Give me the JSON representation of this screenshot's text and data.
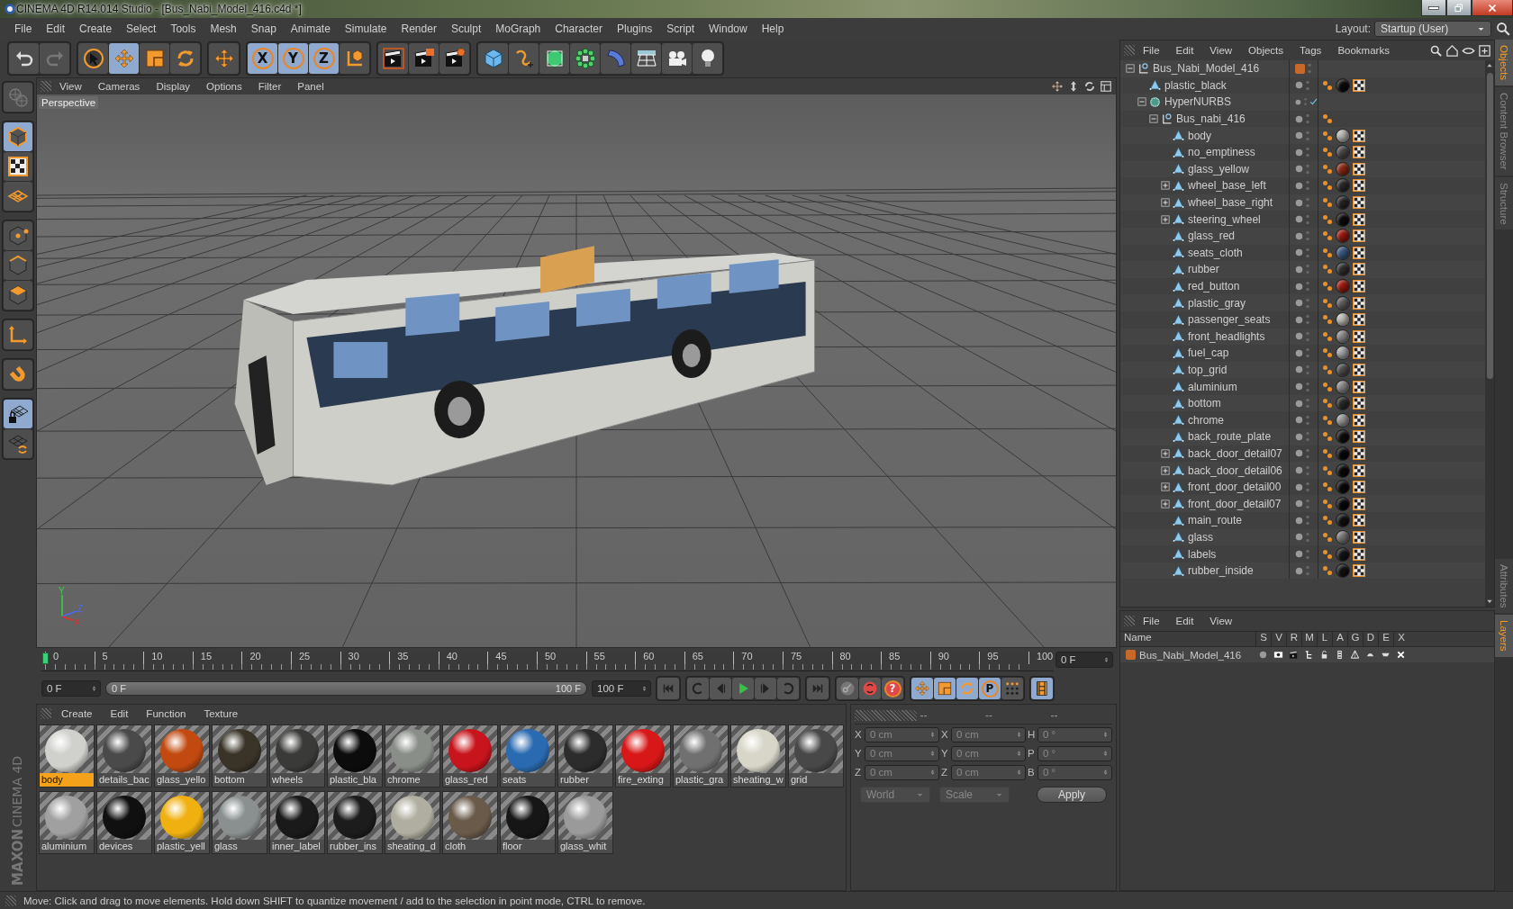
{
  "window": {
    "title": "CINEMA 4D R14.014 Studio - [Bus_Nabi_Model_416.c4d *]"
  },
  "menu": [
    "File",
    "Edit",
    "Create",
    "Select",
    "Tools",
    "Mesh",
    "Snap",
    "Animate",
    "Simulate",
    "Render",
    "Sculpt",
    "MoGraph",
    "Character",
    "Plugins",
    "Script",
    "Window",
    "Help"
  ],
  "layout": {
    "label": "Layout:",
    "value": "Startup (User)"
  },
  "toolbar": [
    [
      {
        "kind": "undo",
        "active": false
      },
      {
        "kind": "redo",
        "active": false
      }
    ],
    [
      {
        "kind": "pointer",
        "active": false
      },
      {
        "kind": "move",
        "active": true
      },
      {
        "kind": "scale",
        "active": false
      },
      {
        "kind": "rotate",
        "active": false
      }
    ],
    [
      {
        "kind": "move",
        "active": false
      }
    ],
    [
      {
        "kind": "axis",
        "label": "X",
        "active": true
      },
      {
        "kind": "axis",
        "label": "Y",
        "active": true
      },
      {
        "kind": "axis",
        "label": "Z",
        "active": true
      },
      {
        "kind": "coord",
        "active": false
      }
    ],
    [
      {
        "kind": "render-view",
        "active": false
      },
      {
        "kind": "render-picture",
        "active": false
      },
      {
        "kind": "render-settings",
        "active": false
      }
    ],
    [
      {
        "kind": "cube",
        "active": false
      },
      {
        "kind": "spline",
        "active": false
      },
      {
        "kind": "nurbs",
        "active": false
      },
      {
        "kind": "array",
        "active": false
      },
      {
        "kind": "deformer",
        "active": false
      },
      {
        "kind": "floor",
        "active": false
      },
      {
        "kind": "camera",
        "active": false
      },
      {
        "kind": "light",
        "active": false
      }
    ]
  ],
  "mode_bar": [
    [
      {
        "kind": "globe",
        "active": false
      }
    ],
    [
      {
        "kind": "model",
        "active": true
      },
      {
        "kind": "checker",
        "active": false
      },
      {
        "kind": "workplane",
        "active": false
      }
    ],
    [
      {
        "kind": "points",
        "active": false
      },
      {
        "kind": "edges",
        "active": false
      },
      {
        "kind": "polygons",
        "active": false
      }
    ],
    [
      {
        "kind": "axes",
        "active": false
      }
    ],
    [
      {
        "kind": "magnet",
        "active": false
      }
    ],
    [
      {
        "kind": "grid-lock",
        "active": true
      },
      {
        "kind": "grid-rotate",
        "active": false
      }
    ]
  ],
  "brand": {
    "company": "MAXON",
    "product": "CINEMA 4D"
  },
  "viewport": {
    "menu": [
      "View",
      "Cameras",
      "Display",
      "Options",
      "Filter",
      "Panel"
    ],
    "camera_label": "Perspective",
    "axis_labels": [
      "Y",
      "Z",
      "X"
    ]
  },
  "timeline": {
    "ticks": [
      "0",
      "5",
      "10",
      "15",
      "20",
      "25",
      "30",
      "35",
      "40",
      "45",
      "50",
      "55",
      "60",
      "65",
      "70",
      "75",
      "80",
      "85",
      "90",
      "95",
      "100"
    ],
    "playhead": {
      "level": 0
    },
    "current_frame": "0 F",
    "start": "0 F",
    "range": {
      "start": "0 F",
      "end": "100 F",
      "level": 1
    },
    "end": "100 F",
    "transport": [
      [
        {
          "kind": "skip-start",
          "active": false
        }
      ],
      [
        {
          "kind": "loop-back",
          "active": false
        },
        {
          "kind": "step-back",
          "active": false
        },
        {
          "kind": "play",
          "active": false
        },
        {
          "kind": "step-forward",
          "active": false
        },
        {
          "kind": "loop-forward",
          "active": false
        }
      ],
      [
        {
          "kind": "skip-end",
          "active": false
        }
      ],
      [
        {
          "kind": "key",
          "active": false
        },
        {
          "kind": "record",
          "active": false
        },
        {
          "kind": "help",
          "label": "?",
          "active": false
        }
      ],
      [
        {
          "kind": "move",
          "active": true
        },
        {
          "kind": "scale",
          "active": true
        },
        {
          "kind": "rotate",
          "active": true
        },
        {
          "kind": "param",
          "label": "P",
          "active": true
        },
        {
          "kind": "dots",
          "active": false
        }
      ],
      [
        {
          "kind": "film",
          "active": true
        }
      ]
    ]
  },
  "materials": {
    "menu": [
      "Create",
      "Edit",
      "Function",
      "Texture"
    ],
    "items": [
      {
        "name": "body",
        "color": "#d0d0cc",
        "selected": true
      },
      {
        "name": "details_bac",
        "color": "#4a4a4a",
        "selected": false
      },
      {
        "name": "glass_yello",
        "color": "#c24a10",
        "selected": false
      },
      {
        "name": "bottom",
        "color": "#3a3428",
        "selected": false
      },
      {
        "name": "wheels",
        "color": "#3a3a38",
        "selected": false
      },
      {
        "name": "plastic_bla",
        "color": "#0c0c0c",
        "selected": false
      },
      {
        "name": "chrome",
        "color": "#8a8e88",
        "selected": false
      },
      {
        "name": "glass_red",
        "color": "#c8141c",
        "selected": false
      },
      {
        "name": "seats",
        "color": "#2a6ab0",
        "selected": false
      },
      {
        "name": "rubber",
        "color": "#2c2c2c",
        "selected": false
      },
      {
        "name": "fire_exting",
        "color": "#d81818",
        "selected": false
      },
      {
        "name": "plastic_gra",
        "color": "#707070",
        "selected": false
      },
      {
        "name": "sheating_w",
        "color": "#d8d6c8",
        "selected": false
      },
      {
        "name": "grid",
        "color": "#484848",
        "selected": false
      },
      {
        "name": "aluminium",
        "color": "#a0a0a0",
        "selected": false
      },
      {
        "name": "devices",
        "color": "#101010",
        "selected": false
      },
      {
        "name": "plastic_yell",
        "color": "#f0b010",
        "selected": false
      },
      {
        "name": "glass",
        "color": "#8a9090",
        "selected": false
      },
      {
        "name": "inner_label",
        "color": "#1a1a1a",
        "selected": false
      },
      {
        "name": "rubber_ins",
        "color": "#1c1c1c",
        "selected": false
      },
      {
        "name": "sheating_d",
        "color": "#b0aea0",
        "selected": false
      },
      {
        "name": "cloth",
        "color": "#6a5a4a",
        "selected": false
      },
      {
        "name": "floor",
        "color": "#161616",
        "selected": false
      },
      {
        "name": "glass_whit",
        "color": "#9a9a9a",
        "selected": false
      }
    ]
  },
  "coordinates": {
    "headers": [
      "--",
      "--",
      "--"
    ],
    "rows": [
      {
        "axis": "X",
        "position": "0 cm",
        "size_axis": "X",
        "size": "0 cm",
        "rotation_axis": "H",
        "rotation": "0 °"
      },
      {
        "axis": "Y",
        "position": "0 cm",
        "size_axis": "Y",
        "size": "0 cm",
        "rotation_axis": "P",
        "rotation": "0 °"
      },
      {
        "axis": "Z",
        "position": "0 cm",
        "size_axis": "Z",
        "size": "0 cm",
        "rotation_axis": "B",
        "rotation": "0 °"
      }
    ],
    "space": "World",
    "mode": "Scale",
    "apply": "Apply"
  },
  "objects": {
    "menu": [
      "File",
      "Edit",
      "View",
      "Objects",
      "Tags",
      "Bookmarks"
    ],
    "tree": [
      {
        "name": "Bus_Nabi_Model_416",
        "kind": "null",
        "expanded": true,
        "layer": {
          "color": "#c8692a"
        },
        "phong": false,
        "children": [
          {
            "name": "plastic_black",
            "kind": "polygon",
            "phong": true,
            "color": "#0a0a0a"
          },
          {
            "name": "HyperNURBS",
            "kind": "nurbs",
            "expanded": true,
            "enabled": true,
            "phong": false,
            "children": [
              {
                "name": "Bus_nabi_416",
                "kind": "null",
                "expanded": true,
                "phong": true,
                "children": [
                  {
                    "name": "body",
                    "kind": "polygon",
                    "phong": true,
                    "color": "#b8b8b4"
                  },
                  {
                    "name": "no_emptiness",
                    "kind": "polygon",
                    "phong": true,
                    "color": "#4a4a4a"
                  },
                  {
                    "name": "glass_yellow",
                    "kind": "polygon",
                    "phong": true,
                    "color": "#8a2a12"
                  },
                  {
                    "name": "wheel_base_left",
                    "kind": "polygon",
                    "expanded": false,
                    "phong": true,
                    "color": "#2a2a2a"
                  },
                  {
                    "name": "wheel_base_right",
                    "kind": "polygon",
                    "expanded": false,
                    "phong": true,
                    "color": "#262626"
                  },
                  {
                    "name": "steering_wheel",
                    "kind": "polygon",
                    "expanded": false,
                    "phong": true,
                    "color": "#0a0a0a"
                  },
                  {
                    "name": "glass_red",
                    "kind": "polygon",
                    "phong": true,
                    "color": "#9a1a10"
                  },
                  {
                    "name": "seats_cloth",
                    "kind": "polygon",
                    "phong": true,
                    "color": "#3a5a80"
                  },
                  {
                    "name": "rubber",
                    "kind": "polygon",
                    "phong": true,
                    "color": "#303030"
                  },
                  {
                    "name": "red_button",
                    "kind": "polygon",
                    "phong": true,
                    "color": "#a01a10"
                  },
                  {
                    "name": "plastic_gray",
                    "kind": "polygon",
                    "phong": true,
                    "color": "#606060"
                  },
                  {
                    "name": "passenger_seats",
                    "kind": "polygon",
                    "phong": true,
                    "color": "#c0beb8"
                  },
                  {
                    "name": "front_headlights",
                    "kind": "polygon",
                    "phong": true,
                    "color": "#8a8a8a"
                  },
                  {
                    "name": "fuel_cap",
                    "kind": "polygon",
                    "phong": true,
                    "color": "#a8a8a8"
                  },
                  {
                    "name": "top_grid",
                    "kind": "polygon",
                    "phong": true,
                    "color": "#505050"
                  },
                  {
                    "name": "aluminium",
                    "kind": "polygon",
                    "phong": true,
                    "color": "#8a8a8a"
                  },
                  {
                    "name": "bottom",
                    "kind": "polygon",
                    "phong": true,
                    "color": "#2a2a28"
                  },
                  {
                    "name": "chrome",
                    "kind": "polygon",
                    "phong": true,
                    "color": "#9a9a9a"
                  },
                  {
                    "name": "back_route_plate",
                    "kind": "polygon",
                    "phong": true,
                    "color": "#0e0e0e"
                  },
                  {
                    "name": "back_door_detail07",
                    "kind": "polygon",
                    "expanded": false,
                    "phong": true,
                    "color": "#080808"
                  },
                  {
                    "name": "back_door_detail06",
                    "kind": "polygon",
                    "expanded": false,
                    "phong": true,
                    "color": "#080808"
                  },
                  {
                    "name": "front_door_detail00",
                    "kind": "polygon",
                    "expanded": false,
                    "phong": true,
                    "color": "#080808"
                  },
                  {
                    "name": "front_door_detail07",
                    "kind": "polygon",
                    "expanded": false,
                    "phong": true,
                    "color": "#080808"
                  },
                  {
                    "name": "main_route",
                    "kind": "polygon",
                    "phong": true,
                    "color": "#101010"
                  },
                  {
                    "name": "glass",
                    "kind": "polygon",
                    "phong": true,
                    "color": "#7a7a7a"
                  },
                  {
                    "name": "labels",
                    "kind": "polygon",
                    "phong": true,
                    "color": "#151515"
                  },
                  {
                    "name": "rubber_inside",
                    "kind": "polygon",
                    "phong": true,
                    "color": "#121212"
                  }
                ]
              }
            ]
          }
        ]
      }
    ]
  },
  "layers": {
    "menu": [
      "File",
      "Edit",
      "View"
    ],
    "columns": [
      "Name",
      "S",
      "V",
      "R",
      "M",
      "L",
      "A",
      "G",
      "D",
      "E",
      "X"
    ],
    "rows": [
      {
        "name": "Bus_Nabi_Model_416",
        "color": "#c8692a"
      }
    ]
  },
  "side_tabs_top": [
    {
      "label": "Objects",
      "selected": true
    },
    {
      "label": "Content Browser",
      "selected": false
    },
    {
      "label": "Structure",
      "selected": false
    }
  ],
  "side_tabs_bottom": [
    {
      "label": "Attributes",
      "selected": false
    },
    {
      "label": "Layers",
      "selected": true
    }
  ],
  "status_bar": "Move: Click and drag to move elements. Hold down SHIFT to quantize movement / add to the selection in point mode, CTRL to remove."
}
